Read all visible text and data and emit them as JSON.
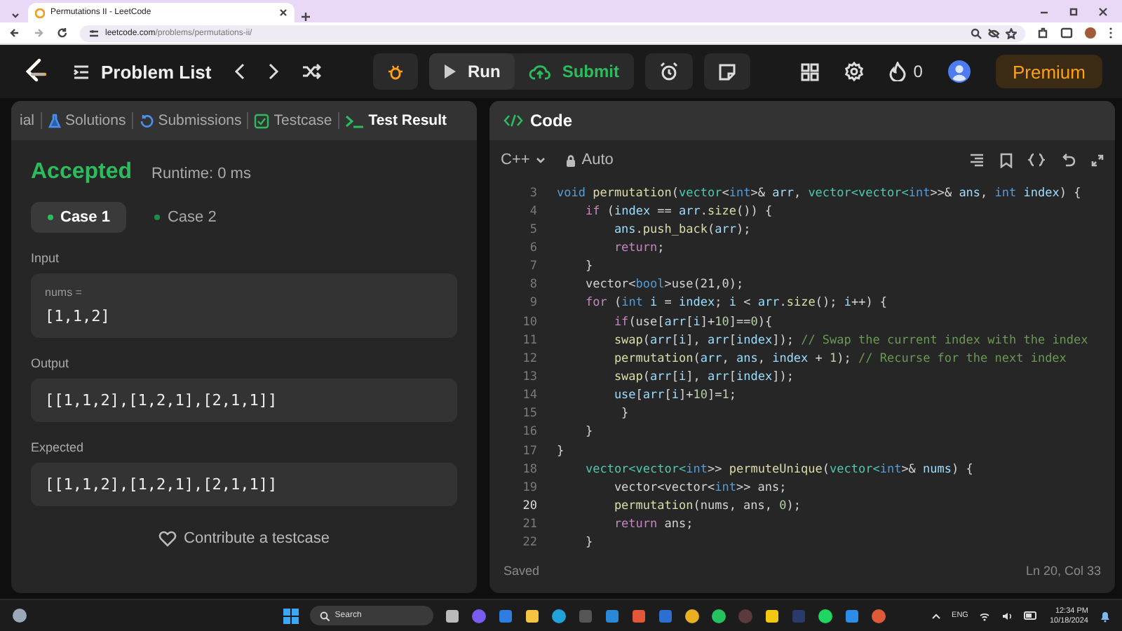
{
  "browser": {
    "tab_title": "Permutations II - LeetCode",
    "url_host": "leetcode.com",
    "url_path": "/problems/permutations-ii/"
  },
  "header": {
    "problem_list": "Problem List",
    "run": "Run",
    "submit": "Submit",
    "streak": "0",
    "premium": "Premium"
  },
  "result_panel": {
    "tabs": [
      {
        "label": "ial",
        "selected": false,
        "kind": "plain"
      },
      {
        "label": "Solutions",
        "selected": false,
        "kind": "flask"
      },
      {
        "label": "Submissions",
        "selected": false,
        "kind": "history"
      },
      {
        "label": "Testcase",
        "selected": false,
        "kind": "check"
      },
      {
        "label": "Test Result",
        "selected": true,
        "kind": "terminal"
      }
    ],
    "status": "Accepted",
    "runtime": "Runtime: 0 ms",
    "cases": [
      {
        "label": "Case 1",
        "selected": true
      },
      {
        "label": "Case 2",
        "selected": false
      }
    ],
    "input_label": "Input",
    "input_param": "nums =",
    "input_value": "[1,1,2]",
    "output_label": "Output",
    "output_value": "[[1,1,2],[1,2,1],[2,1,1]]",
    "expected_label": "Expected",
    "expected_value": "[[1,1,2],[1,2,1],[2,1,1]]",
    "contribute": "Contribute a testcase"
  },
  "code_panel": {
    "title": "Code",
    "language": "C++",
    "mode": "Auto",
    "saved": "Saved",
    "cursor": "Ln 20, Col 33",
    "lines": [
      {
        "number": "3",
        "current": false,
        "tokens": [
          {
            "kind": "type",
            "text": "void "
          },
          {
            "kind": "fn",
            "text": "permutation"
          },
          {
            "kind": "plain",
            "text": "("
          },
          {
            "kind": "cls",
            "text": "vector"
          },
          {
            "kind": "plain",
            "text": "<"
          },
          {
            "kind": "type",
            "text": "int"
          },
          {
            "kind": "plain",
            "text": ">& "
          },
          {
            "kind": "var",
            "text": "arr"
          },
          {
            "kind": "plain",
            "text": ", "
          },
          {
            "kind": "cls",
            "text": "vector<vector<"
          },
          {
            "kind": "type",
            "text": "int"
          },
          {
            "kind": "plain",
            "text": ">>& "
          },
          {
            "kind": "var",
            "text": "ans"
          },
          {
            "kind": "plain",
            "text": ", "
          },
          {
            "kind": "type",
            "text": "int "
          },
          {
            "kind": "var",
            "text": "index"
          },
          {
            "kind": "plain",
            "text": ") {"
          }
        ]
      },
      {
        "number": "4",
        "current": false,
        "tokens": [
          {
            "kind": "kw",
            "text": "    if"
          },
          {
            "kind": "plain",
            "text": " ("
          },
          {
            "kind": "var",
            "text": "index"
          },
          {
            "kind": "plain",
            "text": " == "
          },
          {
            "kind": "var",
            "text": "arr"
          },
          {
            "kind": "plain",
            "text": "."
          },
          {
            "kind": "fn",
            "text": "size"
          },
          {
            "kind": "plain",
            "text": "()) {"
          }
        ]
      },
      {
        "number": "5",
        "current": false,
        "tokens": [
          {
            "kind": "var",
            "text": "        ans"
          },
          {
            "kind": "plain",
            "text": "."
          },
          {
            "kind": "fn",
            "text": "push_back"
          },
          {
            "kind": "plain",
            "text": "("
          },
          {
            "kind": "var",
            "text": "arr"
          },
          {
            "kind": "plain",
            "text": ");"
          }
        ]
      },
      {
        "number": "6",
        "current": false,
        "tokens": [
          {
            "kind": "kw",
            "text": "        return"
          },
          {
            "kind": "plain",
            "text": ";"
          }
        ]
      },
      {
        "number": "7",
        "current": false,
        "tokens": [
          {
            "kind": "plain",
            "text": "    }"
          }
        ]
      },
      {
        "number": "8",
        "current": false,
        "tokens": [
          {
            "kind": "plain",
            "text": "    vector<"
          },
          {
            "kind": "type",
            "text": "bool"
          },
          {
            "kind": "plain",
            "text": ">use(21,0);"
          }
        ]
      },
      {
        "number": "9",
        "current": false,
        "tokens": [
          {
            "kind": "kw",
            "text": "    for"
          },
          {
            "kind": "plain",
            "text": " ("
          },
          {
            "kind": "type",
            "text": "int"
          },
          {
            "kind": "var",
            "text": " i"
          },
          {
            "kind": "plain",
            "text": " = "
          },
          {
            "kind": "var",
            "text": "index"
          },
          {
            "kind": "plain",
            "text": "; "
          },
          {
            "kind": "var",
            "text": "i"
          },
          {
            "kind": "plain",
            "text": " < "
          },
          {
            "kind": "var",
            "text": "arr"
          },
          {
            "kind": "plain",
            "text": "."
          },
          {
            "kind": "fn",
            "text": "size"
          },
          {
            "kind": "plain",
            "text": "(); "
          },
          {
            "kind": "var",
            "text": "i"
          },
          {
            "kind": "plain",
            "text": "++) {"
          }
        ]
      },
      {
        "number": "10",
        "current": false,
        "tokens": [
          {
            "kind": "kw",
            "text": "        if"
          },
          {
            "kind": "plain",
            "text": "(use["
          },
          {
            "kind": "var",
            "text": "arr"
          },
          {
            "kind": "plain",
            "text": "["
          },
          {
            "kind": "var",
            "text": "i"
          },
          {
            "kind": "plain",
            "text": "]+"
          },
          {
            "kind": "num",
            "text": "10"
          },
          {
            "kind": "plain",
            "text": "]=="
          },
          {
            "kind": "num",
            "text": "0"
          },
          {
            "kind": "plain",
            "text": "){"
          }
        ]
      },
      {
        "number": "11",
        "current": false,
        "tokens": [
          {
            "kind": "fn",
            "text": "        swap"
          },
          {
            "kind": "plain",
            "text": "("
          },
          {
            "kind": "var",
            "text": "arr"
          },
          {
            "kind": "plain",
            "text": "["
          },
          {
            "kind": "var",
            "text": "i"
          },
          {
            "kind": "plain",
            "text": "], "
          },
          {
            "kind": "var",
            "text": "arr"
          },
          {
            "kind": "plain",
            "text": "["
          },
          {
            "kind": "var",
            "text": "index"
          },
          {
            "kind": "plain",
            "text": "]); "
          },
          {
            "kind": "comment",
            "text": "// Swap the current index with the index"
          }
        ]
      },
      {
        "number": "12",
        "current": false,
        "tokens": [
          {
            "kind": "fn",
            "text": "        permutation"
          },
          {
            "kind": "plain",
            "text": "("
          },
          {
            "kind": "var",
            "text": "arr"
          },
          {
            "kind": "plain",
            "text": ", "
          },
          {
            "kind": "var",
            "text": "ans"
          },
          {
            "kind": "plain",
            "text": ", "
          },
          {
            "kind": "var",
            "text": "index"
          },
          {
            "kind": "plain",
            "text": " + "
          },
          {
            "kind": "num",
            "text": "1"
          },
          {
            "kind": "plain",
            "text": "); "
          },
          {
            "kind": "comment",
            "text": "// Recurse for the next index"
          }
        ]
      },
      {
        "number": "13",
        "current": false,
        "tokens": [
          {
            "kind": "fn",
            "text": "        swap"
          },
          {
            "kind": "plain",
            "text": "("
          },
          {
            "kind": "var",
            "text": "arr"
          },
          {
            "kind": "plain",
            "text": "["
          },
          {
            "kind": "var",
            "text": "i"
          },
          {
            "kind": "plain",
            "text": "], "
          },
          {
            "kind": "var",
            "text": "arr"
          },
          {
            "kind": "plain",
            "text": "["
          },
          {
            "kind": "var",
            "text": "index"
          },
          {
            "kind": "plain",
            "text": "]);"
          }
        ]
      },
      {
        "number": "14",
        "current": false,
        "tokens": [
          {
            "kind": "var",
            "text": "        use"
          },
          {
            "kind": "plain",
            "text": "["
          },
          {
            "kind": "var",
            "text": "arr"
          },
          {
            "kind": "plain",
            "text": "["
          },
          {
            "kind": "var",
            "text": "i"
          },
          {
            "kind": "plain",
            "text": "]+"
          },
          {
            "kind": "num",
            "text": "10"
          },
          {
            "kind": "plain",
            "text": "]="
          },
          {
            "kind": "num",
            "text": "1"
          },
          {
            "kind": "plain",
            "text": ";"
          }
        ]
      },
      {
        "number": "15",
        "current": false,
        "tokens": [
          {
            "kind": "plain",
            "text": "         }"
          }
        ]
      },
      {
        "number": "16",
        "current": false,
        "tokens": [
          {
            "kind": "plain",
            "text": "    }"
          }
        ]
      },
      {
        "number": "17",
        "current": false,
        "tokens": [
          {
            "kind": "plain",
            "text": "}"
          }
        ]
      },
      {
        "number": "18",
        "current": false,
        "tokens": [
          {
            "kind": "cls",
            "text": "    vector<vector<"
          },
          {
            "kind": "type",
            "text": "int"
          },
          {
            "kind": "plain",
            "text": ">> "
          },
          {
            "kind": "fn",
            "text": "permuteUnique"
          },
          {
            "kind": "plain",
            "text": "("
          },
          {
            "kind": "cls",
            "text": "vector<"
          },
          {
            "kind": "type",
            "text": "int"
          },
          {
            "kind": "plain",
            "text": ">& "
          },
          {
            "kind": "var",
            "text": "nums"
          },
          {
            "kind": "plain",
            "text": ") {"
          }
        ]
      },
      {
        "number": "19",
        "current": false,
        "tokens": [
          {
            "kind": "plain",
            "text": "        vector<vector<"
          },
          {
            "kind": "type",
            "text": "int"
          },
          {
            "kind": "plain",
            "text": ">> ans;"
          }
        ]
      },
      {
        "number": "20",
        "current": true,
        "tokens": [
          {
            "kind": "fn",
            "text": "        permutation"
          },
          {
            "kind": "plain",
            "text": "(nums, ans, "
          },
          {
            "kind": "num",
            "text": "0"
          },
          {
            "kind": "plain",
            "text": ");"
          }
        ]
      },
      {
        "number": "21",
        "current": false,
        "tokens": [
          {
            "kind": "kw",
            "text": "        return"
          },
          {
            "kind": "plain",
            "text": " ans;"
          }
        ]
      },
      {
        "number": "22",
        "current": false,
        "tokens": [
          {
            "kind": "plain",
            "text": "    }"
          }
        ]
      }
    ]
  },
  "taskbar": {
    "search_placeholder": "Search",
    "language": "ENG",
    "time": "12:34 PM",
    "date": "10/18/2024"
  }
}
